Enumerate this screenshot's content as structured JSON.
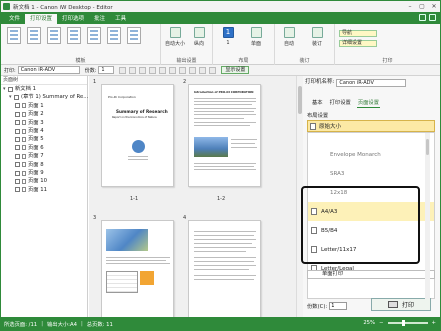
{
  "window": {
    "title": "新文档 1 - Canon iW Desktop - Editor",
    "controls": [
      "–",
      "▢",
      "✕"
    ]
  },
  "menubar": {
    "tabs": [
      "文件",
      "打印设置",
      "打印选项",
      "批注",
      "工具"
    ],
    "active_index": 1
  },
  "ribbon": {
    "groups": {
      "templates": "模板",
      "print_layout": "输出设置",
      "layout": "布局",
      "finishing": "装订",
      "print_options": "打印"
    },
    "buttons": {
      "auto_layout": "自动大小",
      "copies_value": "1",
      "sided": "单面",
      "color": "自动",
      "staple": "装订",
      "orientation": "纵向",
      "n_up": "1"
    },
    "mini": [
      "导航",
      "详细设置"
    ]
  },
  "toolbar": {
    "printer_label": "打印:",
    "printer_value": "Canon iR-ADV",
    "copies_label": "份数:",
    "copies_value": "1",
    "show_toggle": "显示设置"
  },
  "left_panel": {
    "header": "页面树",
    "tree": [
      {
        "label": "新文档 1",
        "level": 0,
        "kind": "root"
      },
      {
        "label": "(章节 1) Summary of Re...",
        "level": 1,
        "kind": "section"
      },
      {
        "label": "页面 1",
        "level": 2,
        "kind": "page"
      },
      {
        "label": "页面 2",
        "level": 2,
        "kind": "page"
      },
      {
        "label": "页面 3",
        "level": 2,
        "kind": "page"
      },
      {
        "label": "页面 4",
        "level": 2,
        "kind": "page"
      },
      {
        "label": "页面 5",
        "level": 2,
        "kind": "page"
      },
      {
        "label": "页面 6",
        "level": 2,
        "kind": "page"
      },
      {
        "label": "页面 7",
        "level": 2,
        "kind": "page"
      },
      {
        "label": "页面 8",
        "level": 2,
        "kind": "page"
      },
      {
        "label": "页面 9",
        "level": 2,
        "kind": "page"
      },
      {
        "label": "页面 10",
        "level": 2,
        "kind": "page"
      },
      {
        "label": "页面 11",
        "level": 2,
        "kind": "page"
      }
    ]
  },
  "preview": {
    "pages": [
      {
        "number": "1",
        "label": "1-1",
        "company": "Pro-Di Corporation",
        "title": "Summary of Research",
        "subtitle": "Report on the bionomics of Nature"
      },
      {
        "number": "2",
        "label": "1-2",
        "heading": "Introduction of PRO-DI CORPORATION"
      },
      {
        "number": "3",
        "label": "1-3"
      },
      {
        "number": "4",
        "label": "1-4"
      }
    ]
  },
  "right_panel": {
    "printer_label": "打印机名称:",
    "printer_value": "Canon iR-ADV",
    "tabs": [
      "基本",
      "打印设置",
      "页面设置"
    ],
    "active_tab": 2,
    "section_label": "布局设置",
    "paper_selected": "原始大小",
    "paper_list": [
      {
        "label": "Envelope Monarch",
        "style": "grey"
      },
      {
        "label": "SRA3",
        "style": "grey"
      },
      {
        "label": "12x18",
        "style": "grey"
      },
      {
        "label": "A4/A3",
        "style": "selected"
      },
      {
        "label": "B5/B4",
        "style": "normal"
      },
      {
        "label": "Letter/11x17",
        "style": "normal"
      },
      {
        "label": "Letter/Legal",
        "style": "normal"
      }
    ],
    "bottom_dropdown": "单面打印",
    "copies_label": "份数(C):",
    "copies_value": "1",
    "print_button": "打印"
  },
  "statusbar": {
    "pages": "所选页面: /11",
    "size": "输出大小:A4",
    "total": "总页数: 11",
    "zoom": "25%"
  }
}
